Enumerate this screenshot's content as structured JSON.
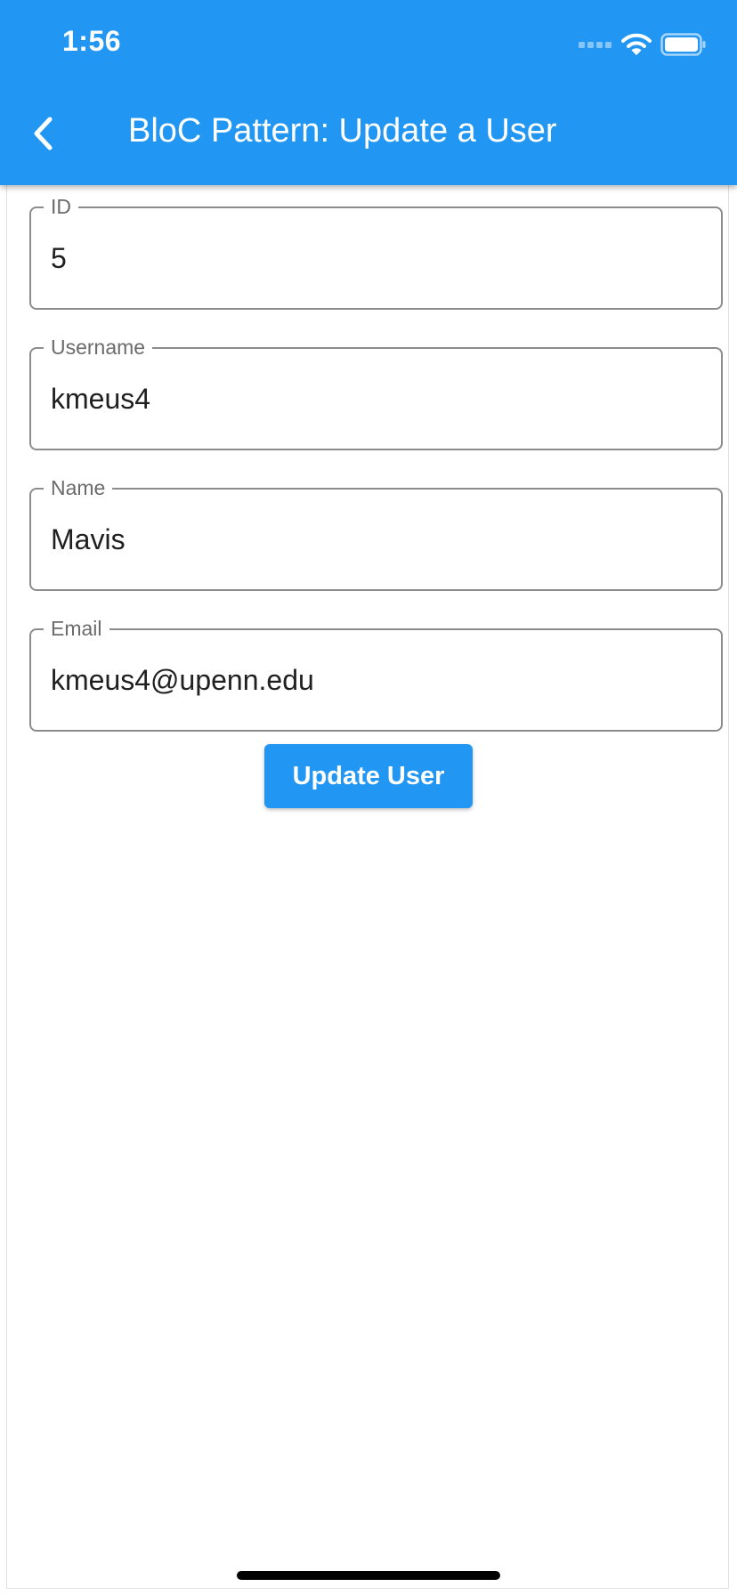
{
  "status_bar": {
    "time": "1:56",
    "icons": [
      "cellular-signal-icon",
      "wifi-icon",
      "battery-icon"
    ]
  },
  "app_bar": {
    "title": "BloC Pattern: Update a User",
    "back_icon": "chevron-left-icon",
    "color": "#2196f3"
  },
  "form": {
    "fields": [
      {
        "label": "ID",
        "value": "5"
      },
      {
        "label": "Username",
        "value": "kmeus4"
      },
      {
        "label": "Name",
        "value": "Mavis"
      },
      {
        "label": "Email",
        "value": "kmeus4@upenn.edu"
      }
    ],
    "submit_label": "Update User",
    "accent": "#2196f3"
  }
}
